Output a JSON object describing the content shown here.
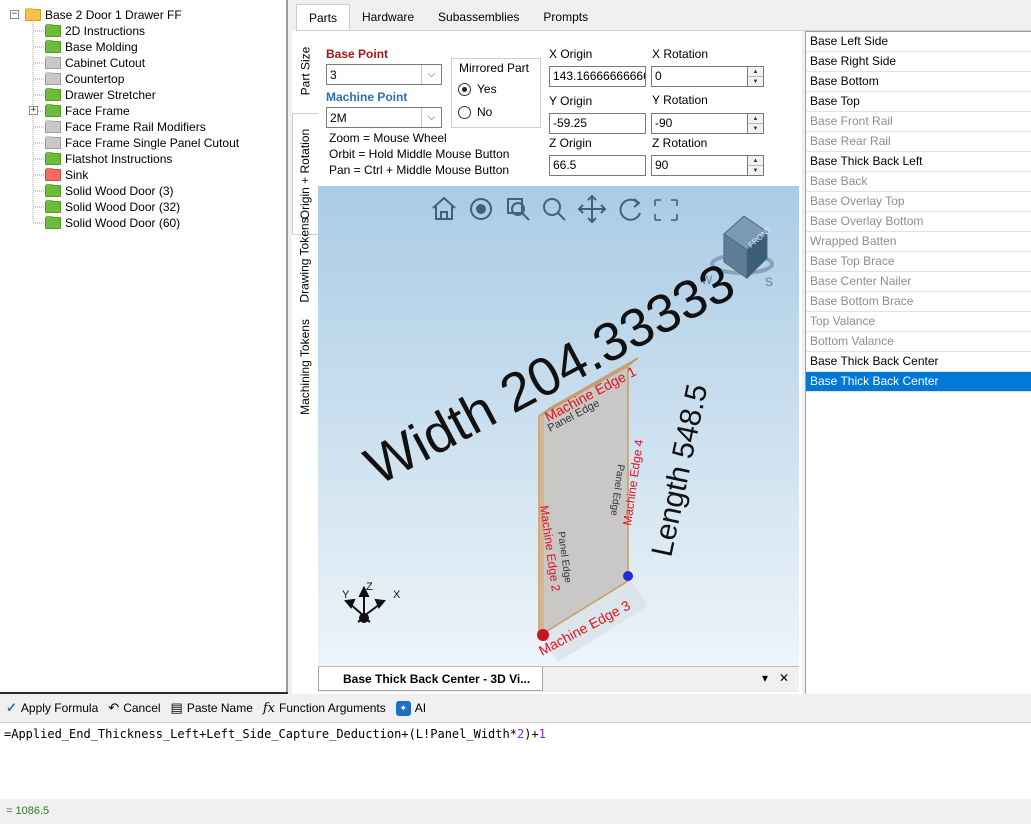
{
  "tree": {
    "root": {
      "label": "Base 2 Door 1 Drawer FF",
      "icon": "folder-open-icon",
      "expander": "−"
    },
    "items": [
      {
        "label": "2D Instructions",
        "color": "green"
      },
      {
        "label": "Base Molding",
        "color": "green"
      },
      {
        "label": "Cabinet Cutout",
        "color": "gray"
      },
      {
        "label": "Countertop",
        "color": "gray"
      },
      {
        "label": "Drawer Stretcher",
        "color": "green"
      },
      {
        "label": "Face Frame",
        "color": "green",
        "expander": "+"
      },
      {
        "label": "Face Frame Rail Modifiers",
        "color": "gray"
      },
      {
        "label": "Face Frame Single Panel Cutout",
        "color": "gray"
      },
      {
        "label": "Flatshot Instructions",
        "color": "green"
      },
      {
        "label": "Sink",
        "color": "red"
      },
      {
        "label": "Solid Wood Door (3)",
        "color": "green"
      },
      {
        "label": "Solid Wood Door (32)",
        "color": "green"
      },
      {
        "label": "Solid Wood Door (60)",
        "color": "green"
      }
    ]
  },
  "tabs": [
    "Parts",
    "Hardware",
    "Subassemblies",
    "Prompts"
  ],
  "side_tabs": [
    "Part Size",
    "Origin + Rotation",
    "Drawing Tokens",
    "Machining Tokens"
  ],
  "origin": {
    "base_point_label": "Base Point",
    "base_point_value": "3",
    "machine_point_label": "Machine Point",
    "machine_point_value": "2M",
    "mirrored_label": "Mirrored Part",
    "yes_label": "Yes",
    "no_label": "No",
    "x_origin_label": "X Origin",
    "x_origin": "143.166666666667",
    "y_origin_label": "Y Origin",
    "y_origin": "-59.25",
    "z_origin_label": "Z Origin",
    "z_origin": "66.5",
    "x_rotation_label": "X Rotation",
    "x_rotation": "0",
    "y_rotation_label": "Y Rotation",
    "y_rotation": "-90",
    "z_rotation_label": "Z Rotation",
    "z_rotation": "90",
    "help_zoom": "Zoom = Mouse Wheel",
    "help_orbit": "Orbit = Hold Middle Mouse Button",
    "help_pan": "Pan = Ctrl + Middle Mouse Button"
  },
  "viewport": {
    "width_text": "Width 204.33333",
    "length_text": "Length 548.5",
    "edge1": "Machine Edge 1",
    "edge2": "Machine Edge 2",
    "edge3": "Machine Edge 3",
    "edge4": "Machine Edge 4",
    "face_text_1": "Panel Edge",
    "face_text_2": "Panel Edge",
    "face_text_3": "Panel Edge",
    "axis_x": "X",
    "axis_y": "Y",
    "axis_z": "Z",
    "cube_label": "FRONT",
    "compass_w": "W",
    "compass_s": "S",
    "tab_label": "Base Thick Back Center - 3D Vi...",
    "tab_dropdown": "▾",
    "tab_close": "✕"
  },
  "parts_list": [
    {
      "label": "Base Left Side",
      "state": "normal"
    },
    {
      "label": "Base Right Side",
      "state": "normal"
    },
    {
      "label": "Base Bottom",
      "state": "normal"
    },
    {
      "label": "Base Top",
      "state": "normal"
    },
    {
      "label": "Base Front Rail",
      "state": "dim"
    },
    {
      "label": "Base Rear Rail",
      "state": "dim"
    },
    {
      "label": "Base Thick Back Left",
      "state": "normal"
    },
    {
      "label": "Base Back",
      "state": "dim"
    },
    {
      "label": "Base Overlay Top",
      "state": "dim"
    },
    {
      "label": "Base Overlay Bottom",
      "state": "dim"
    },
    {
      "label": "Wrapped Batten",
      "state": "dim"
    },
    {
      "label": "Base Top Brace",
      "state": "dim"
    },
    {
      "label": "Base Center Nailer",
      "state": "dim"
    },
    {
      "label": "Base Bottom Brace",
      "state": "dim"
    },
    {
      "label": "Top Valance",
      "state": "dim"
    },
    {
      "label": "Bottom Valance",
      "state": "dim"
    },
    {
      "label": "Base Thick Back Center",
      "state": "normal"
    },
    {
      "label": "Base Thick Back Center",
      "state": "selected"
    }
  ],
  "formula_bar": {
    "apply": "Apply Formula",
    "cancel": "Cancel",
    "paste": "Paste Name",
    "args": "Function Arguments",
    "ai": "AI"
  },
  "formula": {
    "part1": "=Applied_End_Thickness_Left+Left_Side_Capture_Deduction+(L!Panel_Width*",
    "num1": "2",
    "part2": ")+",
    "num2": "1"
  },
  "result": "= 1086.5",
  "colors": {
    "selection": "#0078d7",
    "accent_red": "#a01919",
    "accent_blue": "#2c6fb6",
    "result_green": "#2a7a2a"
  }
}
